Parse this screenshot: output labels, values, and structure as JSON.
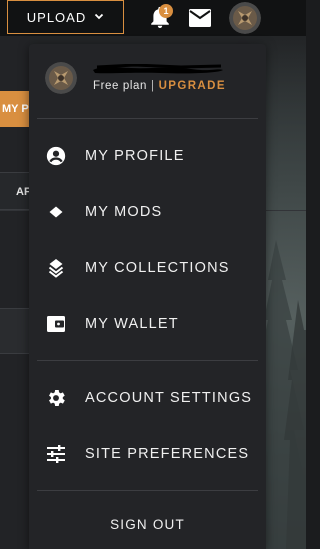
{
  "header": {
    "upload_label": "UPLOAD",
    "notification_count": "1"
  },
  "background": {
    "orange_button_label": "MY PI",
    "tab_label": "AF"
  },
  "user": {
    "plan_label": "Free plan",
    "separator": "|",
    "upgrade_label": "UPGRADE"
  },
  "menu": {
    "items": [
      {
        "label": "MY PROFILE",
        "icon": "account-circle-icon"
      },
      {
        "label": "MY MODS",
        "icon": "diamond-icon"
      },
      {
        "label": "MY COLLECTIONS",
        "icon": "layers-icon"
      },
      {
        "label": "MY WALLET",
        "icon": "wallet-icon"
      },
      {
        "label": "ACCOUNT SETTINGS",
        "icon": "gear-icon"
      },
      {
        "label": "SITE PREFERENCES",
        "icon": "sliders-icon"
      }
    ],
    "sign_out_label": "SIGN OUT"
  },
  "colors": {
    "accent": "#d98f40",
    "menu_bg": "#232427",
    "header_bg": "#111213"
  }
}
